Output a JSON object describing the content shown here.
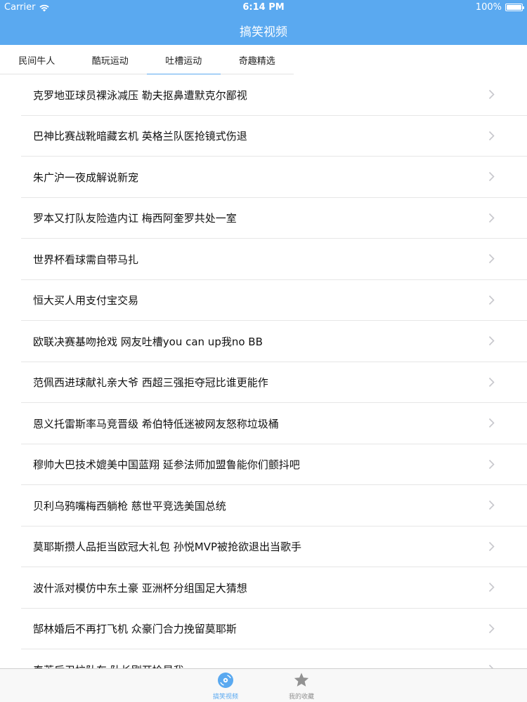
{
  "status_bar": {
    "carrier": "Carrier",
    "time": "6:14 PM",
    "battery": "100%"
  },
  "nav": {
    "title": "搞笑视频"
  },
  "tabs": [
    {
      "label": "民间牛人",
      "active": false
    },
    {
      "label": "酷玩运动",
      "active": false
    },
    {
      "label": "吐槽运动",
      "active": true
    },
    {
      "label": "奇趣精选",
      "active": false
    }
  ],
  "list": {
    "items": [
      "克罗地亚球员裸泳减压 勒夫抠鼻遭默克尔鄙视",
      "巴神比赛战靴暗藏玄机 英格兰队医抢镜式伤退",
      "朱广沪一夜成解说新宠",
      "罗本又打队友险造内讧 梅西阿奎罗共处一室",
      "世界杯看球需自带马扎",
      "恒大买人用支付宝交易",
      "欧联决赛基吻抢戏 网友吐槽you can up我no BB",
      "范佩西进球献礼亲大爷 西超三强拒夺冠比谁更能作",
      "恩义托雷斯率马竞晋级 希伯特低迷被网友怒称垃圾桶",
      "穆帅大巴技术媲美中国蓝翔 延参法师加盟鲁能你们颤抖吧",
      "贝利乌鸦嘴梅西躺枪 慈世平竞选美国总统",
      "莫耶斯攒人品拒当欧冠大礼包 孙悦MVP被抢欲退出当歌手",
      "波什派对模仿中东土豪 亚洲杯分组国足大猜想",
      "郜林婚后不再打飞机 众豪门合力挽留莫耶斯",
      "泰莱后卫拉队车 队长刚开拎是我"
    ]
  },
  "tabbar": {
    "items": [
      {
        "label": "搞笑视频",
        "icon": "disc-icon",
        "active": true
      },
      {
        "label": "我的收藏",
        "icon": "star-icon",
        "active": false
      }
    ]
  },
  "colors": {
    "accent": "#5aa9f0",
    "separator": "#e6e6e6",
    "chevron": "#c7c7cc",
    "inactive": "#929292"
  }
}
